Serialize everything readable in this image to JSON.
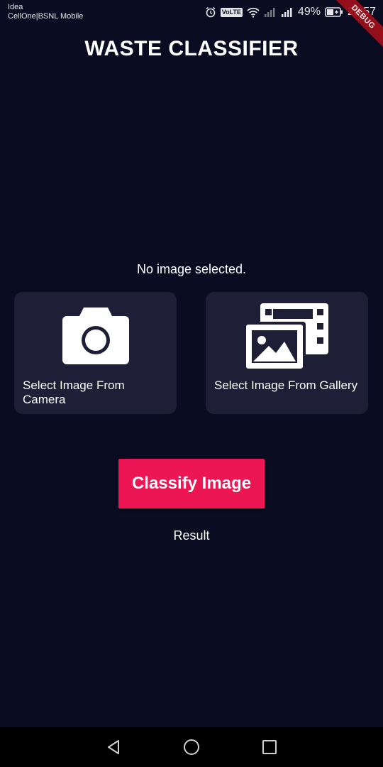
{
  "status_bar": {
    "carrier_line1": "Idea",
    "carrier_line2": "CellOne|BSNL Mobile",
    "volte": "VoLTE",
    "battery_percent": "49%",
    "time": "20:57",
    "icons": [
      "alarm-icon",
      "volte-icon",
      "wifi-icon",
      "signal-icon",
      "signal-icon",
      "battery-icon"
    ]
  },
  "debug_banner": "DEBUG",
  "app": {
    "title": "WASTE  CLASSIFIER",
    "no_image_text": "No image selected.",
    "camera_card": {
      "label": "Select Image From Camera",
      "icon": "camera-icon"
    },
    "gallery_card": {
      "label": "Select Image From Gallery",
      "icon": "gallery-icon"
    },
    "classify_button": "Classify Image",
    "result_text": "Result"
  },
  "nav": {
    "icons": [
      "back-icon",
      "home-icon",
      "recents-icon"
    ]
  },
  "colors": {
    "background": "#0a0d22",
    "card": "#1e1f36",
    "accent": "#ec1655",
    "text": "#ffffff"
  }
}
